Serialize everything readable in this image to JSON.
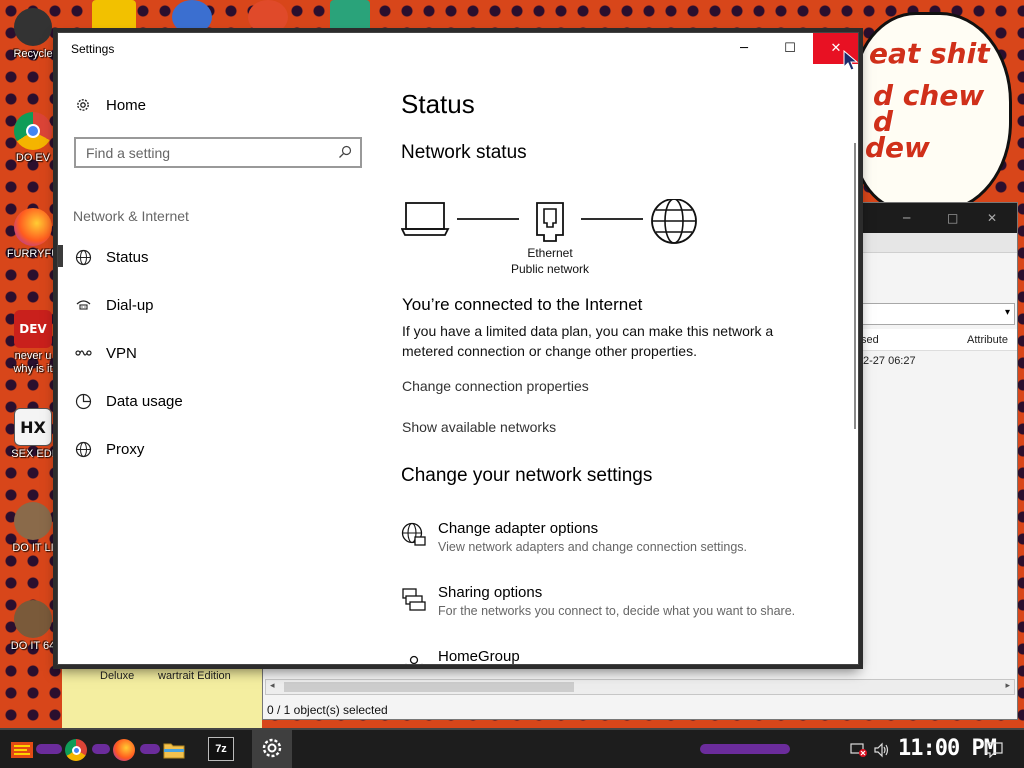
{
  "desktop": {
    "icons": [
      {
        "label": "Recycle"
      },
      {
        "label": "DO EV"
      },
      {
        "label": "FURRYFU"
      },
      {
        "label": "never u",
        "label2": "why is it"
      },
      {
        "label": "SEX EDI"
      },
      {
        "label": "DO IT LI"
      },
      {
        "label": "DO IT 64"
      }
    ],
    "comic_text": [
      "eat shit",
      "d chew",
      "d",
      "dew"
    ],
    "bottom_labels": [
      "Deluxe",
      "wartrait Edition"
    ]
  },
  "explorer": {
    "column_headers": [
      "sed",
      "Attribute"
    ],
    "cell_value": "2-27 06:27",
    "status": "0 / 1 object(s) selected"
  },
  "settings": {
    "window_title": "Settings",
    "nav": {
      "home": "Home",
      "search_placeholder": "Find a setting",
      "section": "Network & Internet",
      "items": [
        {
          "label": "Status",
          "icon": "globe-icon"
        },
        {
          "label": "Dial-up",
          "icon": "dialup-icon"
        },
        {
          "label": "VPN",
          "icon": "vpn-icon"
        },
        {
          "label": "Data usage",
          "icon": "data-usage-icon"
        },
        {
          "label": "Proxy",
          "icon": "globe-icon"
        }
      ]
    },
    "main": {
      "title": "Status",
      "network_status_heading": "Network status",
      "diagram": {
        "adapter_label": "Ethernet",
        "network_label": "Public network"
      },
      "connected_heading": "You’re connected to the Internet",
      "connected_desc": "If you have a limited data plan, you can make this network a metered connection or change other properties.",
      "link_change_props": "Change connection properties",
      "link_show_networks": "Show available networks",
      "change_heading": "Change your network settings",
      "options": [
        {
          "title": "Change adapter options",
          "desc": "View network adapters and change connection settings.",
          "icon": "adapter-icon"
        },
        {
          "title": "Sharing options",
          "desc": "For the networks you connect to, decide what you want to share.",
          "icon": "sharing-icon"
        },
        {
          "title": "HomeGroup",
          "desc": "",
          "icon": "homegroup-icon"
        }
      ]
    }
  },
  "taskbar": {
    "clock": "11:00 PM",
    "sevenzip_label": "7z"
  },
  "colors": {
    "close_button": "#e81123",
    "desktop_bg": "#d8461a",
    "taskbar_bg": "#1d1d1d"
  }
}
